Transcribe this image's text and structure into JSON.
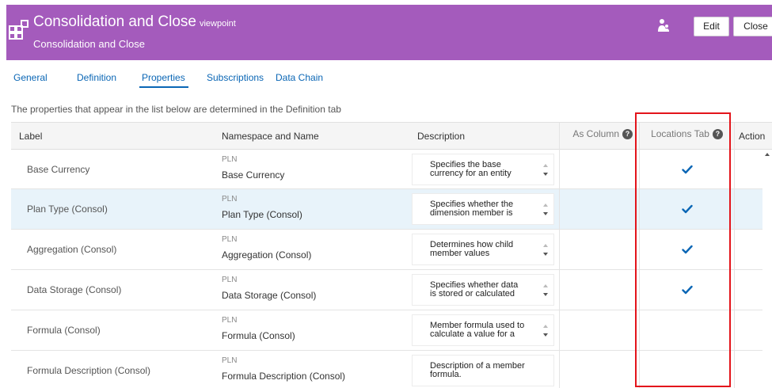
{
  "header": {
    "title": "Consolidation and Close",
    "title_suffix": "viewpoint",
    "subtitle": "Consolidation and Close",
    "edit_label": "Edit",
    "close_label": "Close",
    "icon": "dashboard-grid-icon",
    "people_icon": "users-icon",
    "background": "#a45bbc"
  },
  "tabs": [
    {
      "label": "General"
    },
    {
      "label": "Definition"
    },
    {
      "label": "Properties",
      "active": true
    },
    {
      "label": "Subscriptions"
    },
    {
      "label": "Data Chain"
    }
  ],
  "info_text": "The properties that appear in the list below are determined in the Definition tab",
  "table": {
    "columns": {
      "label": "Label",
      "namespace": "Namespace and Name",
      "description": "Description",
      "as_column": "As Column",
      "locations_tab": "Locations Tab",
      "action": "Action"
    },
    "rows": [
      {
        "label": "Base Currency",
        "namespace": "PLN",
        "name": "Base Currency",
        "desc_line1": "Specifies the base",
        "desc_line2": "currency for an entity",
        "locations_checked": true
      },
      {
        "label": "Plan Type (Consol)",
        "namespace": "PLN",
        "name": "Plan Type (Consol)",
        "desc_line1": "Specifies whether the",
        "desc_line2": "dimension member is",
        "locations_checked": true,
        "selected": true
      },
      {
        "label": "Aggregation (Consol)",
        "namespace": "PLN",
        "name": "Aggregation (Consol)",
        "desc_line1": "Determines how child",
        "desc_line2": "member values",
        "locations_checked": true
      },
      {
        "label": "Data Storage (Consol)",
        "namespace": "PLN",
        "name": "Data Storage (Consol)",
        "desc_line1": "Specifies whether data",
        "desc_line2": "is stored or calculated",
        "locations_checked": true
      },
      {
        "label": "Formula (Consol)",
        "namespace": "PLN",
        "name": "Formula (Consol)",
        "desc_line1": "Member formula used to",
        "desc_line2": "calculate a value for a",
        "locations_checked": false
      },
      {
        "label": "Formula Description (Consol)",
        "namespace": "PLN",
        "name": "Formula Description (Consol)",
        "desc_line1": "Description of a member",
        "desc_line2": "formula.",
        "locations_checked": false
      }
    ]
  },
  "colors": {
    "accent": "#0a66b5",
    "highlight_box": "#e3141b",
    "selected_row": "#e8f3fa"
  }
}
